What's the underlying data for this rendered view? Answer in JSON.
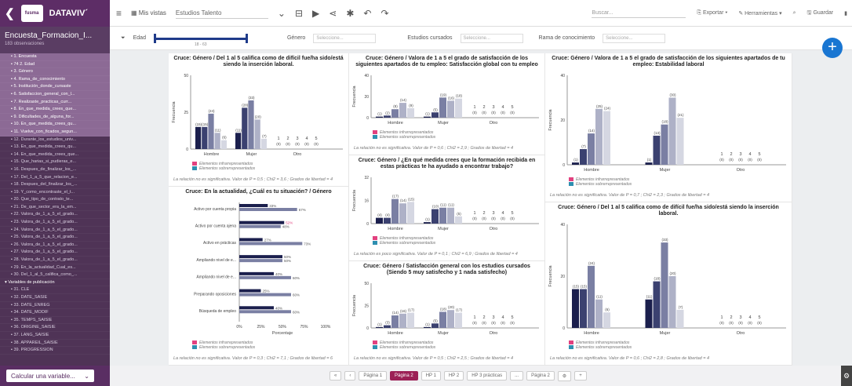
{
  "topbar": {
    "brand": "DATAVIV´",
    "logo_text": "fusma",
    "vistas": "Mis vistas",
    "dataset": "Estudios Talento",
    "search_placeholder": "Buscar...",
    "exportar": "Exportar",
    "herramientas": "Herramientas",
    "guardar": "Guardar"
  },
  "sidebar": {
    "title": "Encuesta_Formacion_I...",
    "subtitle": "183 observaciones",
    "items": [
      {
        "label": "1. Encuesta",
        "hl": true
      },
      {
        "label": "74 2. Edad",
        "hl": true
      },
      {
        "label": "3. Género",
        "hl": true
      },
      {
        "label": "4. Rama_de_conocimiento",
        "hl": true
      },
      {
        "label": "5. Institución_donde_cursaste",
        "hl": true
      },
      {
        "label": "6. Satisfaccion_general_con_l...",
        "hl": true
      },
      {
        "label": "7. Realizaste_practicas_curr...",
        "hl": true
      },
      {
        "label": "8. En_que_medida_crees_que...",
        "hl": true
      },
      {
        "label": "9. Dificultades_de_alguna_for...",
        "hl": true
      },
      {
        "label": "10. En_que_medida_crees_qu...",
        "hl": true
      },
      {
        "label": "11. Vuelve_con_ficados_segun...",
        "hl": true
      },
      {
        "label": "12. Durante_los_estudios_univ...",
        "hl": false
      },
      {
        "label": "13. En_que_medida_crees_qu...",
        "hl": false
      },
      {
        "label": "14. En_que_medida_crees_que...",
        "hl": false
      },
      {
        "label": "15. Que_harias_si_pudieras_e...",
        "hl": false
      },
      {
        "label": "16. Despues_de_finalizar_los_...",
        "hl": false
      },
      {
        "label": "17. Del_1_a_5_que_relacion_e...",
        "hl": false
      },
      {
        "label": "18. Despues_del_finalizar_los_...",
        "hl": false
      },
      {
        "label": "19. Y_como_encontraste_el_t...",
        "hl": false
      },
      {
        "label": "20. Que_tipo_de_contrato_te...",
        "hl": false
      },
      {
        "label": "21. De_que_sector_era_la_em...",
        "hl": false
      },
      {
        "label": "22. Valora_de_1_a_5_el_grado...",
        "hl": false
      },
      {
        "label": "23. Valora_de_1_a_5_el_grado...",
        "hl": false
      },
      {
        "label": "24. Valora_de_1_a_5_el_grado...",
        "hl": false
      },
      {
        "label": "25. Valora_de_1_a_5_el_grado...",
        "hl": false
      },
      {
        "label": "26. Valora_de_1_a_5_el_grado...",
        "hl": false
      },
      {
        "label": "27. Valora_de_1_a_5_el_grado...",
        "hl": false
      },
      {
        "label": "28. Valora_de_1_a_5_el_grado...",
        "hl": false
      },
      {
        "label": "29. En_la_actualidad_Cual_es...",
        "hl": false
      },
      {
        "label": "30. Del_1_al_5_califica_como_...",
        "hl": false
      },
      {
        "label": "Variables de publicación",
        "grp": true
      },
      {
        "label": "31. CLE",
        "hl": false
      },
      {
        "label": "32. DATE_SASIE",
        "hl": false
      },
      {
        "label": "33. DATE_ENREG",
        "hl": false
      },
      {
        "label": "34. DATE_MODIF",
        "hl": false
      },
      {
        "label": "35. TEMPS_SAISIE",
        "hl": false
      },
      {
        "label": "36. ORIGINE_SAISIE",
        "hl": false
      },
      {
        "label": "37. LANG_SAISIE",
        "hl": false
      },
      {
        "label": "38. APPAREIL_SAISIE",
        "hl": false
      },
      {
        "label": "39. PROGRESSION",
        "hl": false
      }
    ]
  },
  "bottombar": {
    "calc": "Calcular una variable..."
  },
  "filters": {
    "edad": "Edad",
    "edad_range": "18 - 63",
    "genero": "Género",
    "estudios": "Estudios cursados",
    "rama": "Rama de conocimiento",
    "placeholder": "Seleccione..."
  },
  "legend": {
    "infra": "Elementos infrarrepresentados",
    "sobre": "Elementos sobrerrepresentados"
  },
  "colors": {
    "c1": "#1b1f4d",
    "c2": "#3b4170",
    "c3": "#7a7fa3",
    "c4": "#aeb1c7",
    "c5": "#d5d7e2",
    "infra": "#e2417f",
    "sobre": "#2e8fb0"
  },
  "chart_data": [
    {
      "type": "bar",
      "title": "Cruce: Género / Del 1 al 5 califica como de difícil fue/ha sido/está siendo la inserción laboral.",
      "categories": [
        "Hombre",
        "Mujer",
        "Otro"
      ],
      "series": [
        {
          "name": "1",
          "values": [
            15,
            11,
            0
          ]
        },
        {
          "name": "2",
          "values": [
            15,
            28,
            0
          ]
        },
        {
          "name": "3",
          "values": [
            24,
            33,
            0
          ]
        },
        {
          "name": "4",
          "values": [
            11,
            20,
            0
          ]
        },
        {
          "name": "5",
          "values": [
            6,
            7,
            0
          ]
        }
      ],
      "ylabel": "Frecuencia",
      "ylim": [
        0,
        50
      ],
      "note": "La relación no es significativa. Valor de P = 0,5 ; Chi2 = 3,6 ; Grados de libertad = 4"
    },
    {
      "type": "bar",
      "title": "Cruce: Género / Valora de 1 a 5 el grado de satisfacción de los siguientes apartados de tu empleo: Satisfacción global con tu empleo",
      "categories": [
        "Hombre",
        "Mujer",
        "Otro"
      ],
      "series": [
        {
          "name": "1",
          "values": [
            1,
            1,
            0
          ]
        },
        {
          "name": "2",
          "values": [
            2,
            5,
            0
          ]
        },
        {
          "name": "3",
          "values": [
            8,
            19,
            0
          ]
        },
        {
          "name": "4",
          "values": [
            14,
            16,
            0
          ]
        },
        {
          "name": "5",
          "values": [
            9,
            18,
            0
          ]
        }
      ],
      "ylabel": "Frecuencia",
      "ylim": [
        0,
        40
      ],
      "note": "La relación no es significativa. Valor de P = 0,6 ; Chi2 = 2,9 ; Grados de libertad = 4"
    },
    {
      "type": "bar",
      "title": "Cruce: Género / Valora de 1 a 5 el grado de satisfacción de los siguientes apartados de tu empleo: Estabilidad laboral",
      "categories": [
        "Hombre",
        "Mujer",
        "Otro"
      ],
      "series": [
        {
          "name": "1",
          "values": [
            1,
            1,
            0
          ]
        },
        {
          "name": "2",
          "values": [
            7,
            13,
            0
          ]
        },
        {
          "name": "3",
          "values": [
            14,
            18,
            0
          ]
        },
        {
          "name": "4",
          "values": [
            25,
            30,
            0
          ]
        },
        {
          "name": "5",
          "values": [
            24,
            21,
            0
          ]
        }
      ],
      "ylabel": "Frecuencia",
      "ylim": [
        0,
        40
      ],
      "note": "La relación no es significativa. Valor de P = 0,7 ; Chi2 = 2,3 ; Grados de libertad = 4"
    },
    {
      "type": "bar",
      "title": "Cruce: Género / ¿En qué medida crees que la formación recibida en estas prácticas te ha ayudado a encontrar trabajo?",
      "categories": [
        "Hombre",
        "Mujer",
        "Otro"
      ],
      "series": [
        {
          "name": "1",
          "values": [
            4,
            1,
            0
          ]
        },
        {
          "name": "2",
          "values": [
            4,
            10,
            0
          ]
        },
        {
          "name": "3",
          "values": [
            17,
            11,
            0
          ]
        },
        {
          "name": "4",
          "values": [
            14,
            11,
            0
          ]
        },
        {
          "name": "5",
          "values": [
            15,
            5,
            0
          ]
        }
      ],
      "ylabel": "Frecuencia",
      "ylim": [
        0,
        32
      ],
      "note": "La relación es poco significativa. Valor de P = 0,1 ; Chi2 = 6,9 ; Grados de libertad = 4"
    },
    {
      "type": "bar",
      "title": "Cruce: Género / Satisfacción general con los estudios cursados (Siendo 5 muy satisfecho y 1 nada satisfecho)",
      "categories": [
        "Hombre",
        "Mujer",
        "Otro"
      ],
      "series": [
        {
          "name": "1",
          "values": [
            1,
            1,
            0
          ]
        },
        {
          "name": "2",
          "values": [
            3,
            5,
            0
          ]
        },
        {
          "name": "3",
          "values": [
            14,
            18,
            0
          ]
        },
        {
          "name": "4",
          "values": [
            16,
            20,
            0
          ]
        },
        {
          "name": "5",
          "values": [
            17,
            17,
            0
          ]
        }
      ],
      "ylabel": "Frecuencia",
      "ylim": [
        0,
        50
      ],
      "note": "La relación no es significativa. Valor de P = 0,5 ; Chi2 = 2,5 ; Grados de libertad = 4"
    },
    {
      "type": "bar",
      "title": "Cruce: En la actualidad, ¿Cuál es tu situación? / Género",
      "orientation": "horizontal",
      "categories": [
        "Activo por cuenta propia",
        "Activo por cuenta ajena",
        "Activo en prácticas",
        "Ampliando nivel de e...",
        "Ampliando nivel de e...",
        "Preparando oposiciones",
        "Búsqueda de empleo"
      ],
      "series": [
        {
          "name": "Hombre",
          "values": [
            33,
            52,
            27,
            50,
            40,
            25,
            40
          ]
        },
        {
          "name": "Mujer",
          "values": [
            67,
            48,
            73,
            50,
            60,
            60,
            60
          ]
        }
      ],
      "xlabel": "Porcentaje",
      "xlim": [
        0,
        100
      ],
      "xticks": [
        "0%",
        "25%",
        "50%",
        "75%",
        "100%"
      ],
      "note": "La relación no es significativa. Valor de P = 0,3 ; Chi2 = 7,1 ; Grados de libertad = 6"
    },
    {
      "type": "bar",
      "title": "Cruce: Género / Del 1 al 5 califica como de difícil fue/ha sido/está siendo la inserción laboral.",
      "categories": [
        "Hombre",
        "Mujer",
        "Otro"
      ],
      "series": [
        {
          "name": "1",
          "values": [
            15,
            11,
            0
          ]
        },
        {
          "name": "2",
          "values": [
            15,
            18,
            0
          ]
        },
        {
          "name": "3",
          "values": [
            24,
            33,
            0
          ]
        },
        {
          "name": "4",
          "values": [
            11,
            20,
            0
          ]
        },
        {
          "name": "5",
          "values": [
            6,
            7,
            0
          ]
        }
      ],
      "ylabel": "Frecuencia",
      "ylim": [
        0,
        40
      ],
      "note": "La relación no es significativa. Valor de P = 0,6 ; Chi2 = 2,8 ; Grados de libertad = 4"
    }
  ],
  "pager": {
    "pages": [
      "Página 1",
      "Página 2",
      "HP 1",
      "HP 2",
      "HP 3 prácticas",
      "...",
      "Página 2"
    ],
    "active": 1
  }
}
